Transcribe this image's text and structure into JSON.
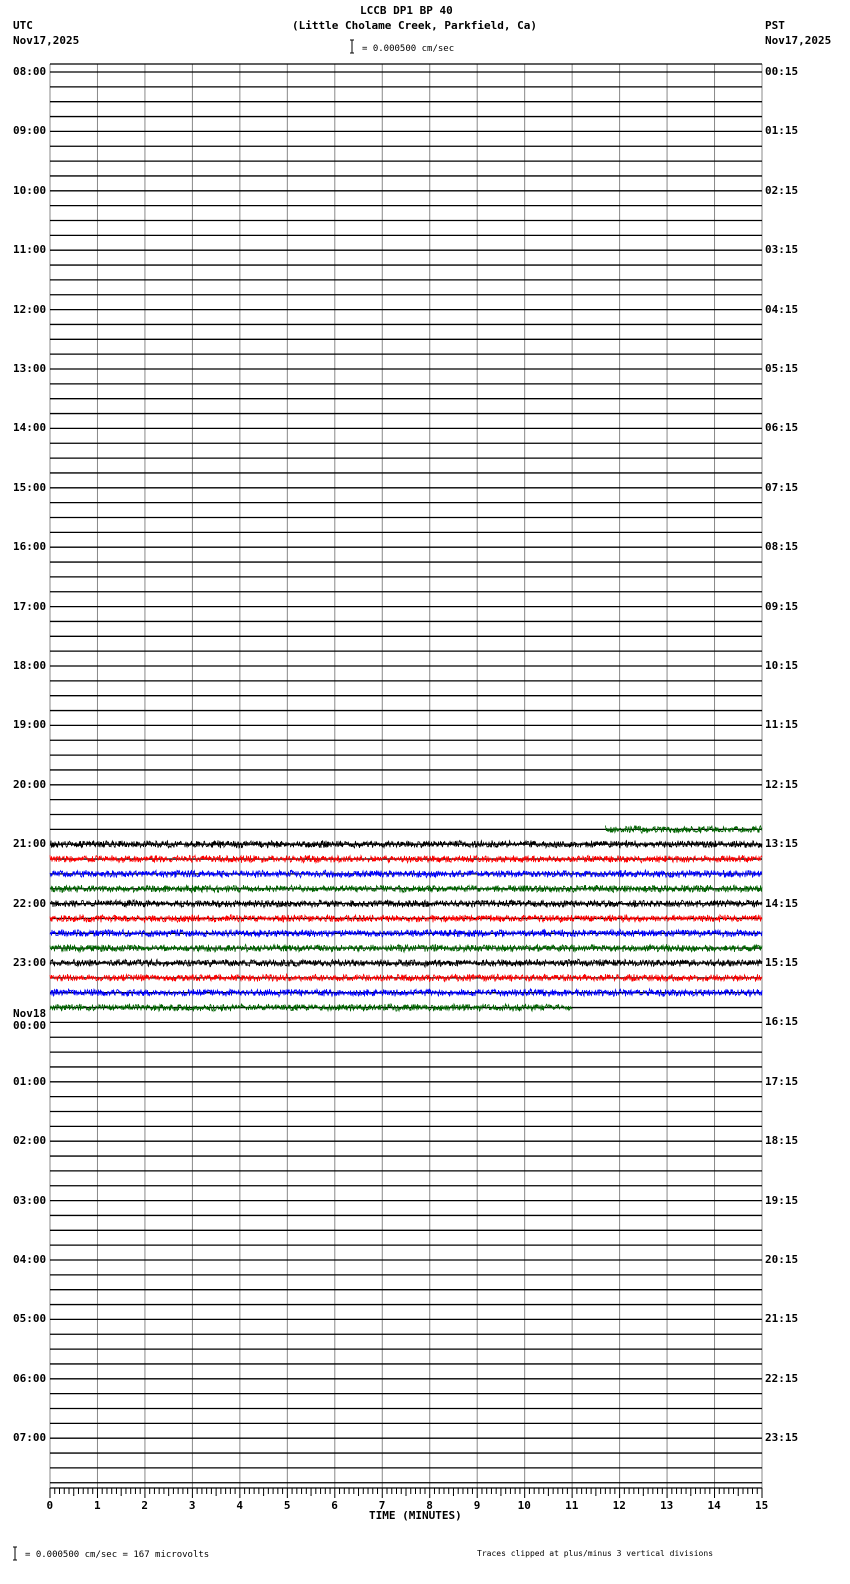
{
  "header": {
    "title": "LCCB DP1 BP 40",
    "subtitle": "(Little Cholame Creek, Parkfield, Ca)",
    "left_tz": "UTC",
    "left_date": "Nov17,2025",
    "right_tz": "PST",
    "right_date": "Nov17,2025",
    "scale_text": "= 0.000500 cm/sec"
  },
  "footer": {
    "scale_text": "= 0.000500 cm/sec =     167 microvolts",
    "clip_note": "Traces clipped at plus/minus 3 vertical divisions"
  },
  "chart_data": {
    "type": "line",
    "title": "LCCB DP1 BP 40",
    "xlabel": "TIME (MINUTES)",
    "xlim": [
      0,
      15
    ],
    "x_ticks": [
      "0",
      "1",
      "2",
      "3",
      "4",
      "5",
      "6",
      "7",
      "8",
      "9",
      "10",
      "11",
      "12",
      "13",
      "14",
      "15"
    ],
    "rows_per_hour": 4,
    "total_rows": 96,
    "left_labels": [
      "08:00",
      "09:00",
      "10:00",
      "11:00",
      "12:00",
      "13:00",
      "14:00",
      "15:00",
      "16:00",
      "17:00",
      "18:00",
      "19:00",
      "20:00",
      "21:00",
      "22:00",
      "23:00",
      "00:00",
      "01:00",
      "02:00",
      "03:00",
      "04:00",
      "05:00",
      "06:00",
      "07:00"
    ],
    "left_date_change": {
      "hour_index": 16,
      "label": "Nov18"
    },
    "right_labels": [
      "00:15",
      "01:15",
      "02:15",
      "03:15",
      "04:15",
      "05:15",
      "06:15",
      "07:15",
      "08:15",
      "09:15",
      "10:15",
      "11:15",
      "12:15",
      "13:15",
      "14:15",
      "15:15",
      "16:15",
      "17:15",
      "18:15",
      "19:15",
      "20:15",
      "21:15",
      "22:15",
      "23:15"
    ],
    "trace_colors": [
      "#000000",
      "#ff0000",
      "#0000ff",
      "#006400"
    ],
    "traces": [
      {
        "row": 51,
        "start_min": 11.7,
        "end_min": 15,
        "color": "#006400"
      },
      {
        "row": 52,
        "start_min": 0,
        "end_min": 15,
        "color": "#000000"
      },
      {
        "row": 53,
        "start_min": 0,
        "end_min": 15,
        "color": "#ff0000"
      },
      {
        "row": 54,
        "start_min": 0,
        "end_min": 15,
        "color": "#0000ff"
      },
      {
        "row": 55,
        "start_min": 0,
        "end_min": 15,
        "color": "#006400"
      },
      {
        "row": 56,
        "start_min": 0,
        "end_min": 15,
        "color": "#000000"
      },
      {
        "row": 57,
        "start_min": 0,
        "end_min": 15,
        "color": "#ff0000"
      },
      {
        "row": 58,
        "start_min": 0,
        "end_min": 15,
        "color": "#0000ff"
      },
      {
        "row": 59,
        "start_min": 0,
        "end_min": 15,
        "color": "#006400"
      },
      {
        "row": 60,
        "start_min": 0,
        "end_min": 15,
        "color": "#000000"
      },
      {
        "row": 61,
        "start_min": 0,
        "end_min": 15,
        "color": "#ff0000"
      },
      {
        "row": 62,
        "start_min": 0,
        "end_min": 15,
        "color": "#0000ff"
      },
      {
        "row": 63,
        "start_min": 0,
        "end_min": 11,
        "color": "#006400"
      }
    ]
  }
}
